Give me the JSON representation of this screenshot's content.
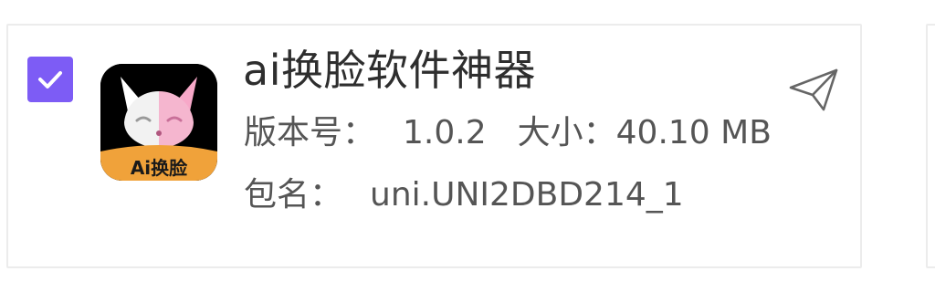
{
  "app": {
    "name": "ai换脸软件神器",
    "icon_label": "Ai换脸",
    "selected": true,
    "version_label": "版本号：",
    "version": "1.0.2",
    "size_label": "大小：",
    "size": "40.10 MB",
    "package_label": "包名：",
    "package": "uni.UNI2DBD214_1"
  },
  "icons": {
    "checkbox": "checkmark-icon",
    "share": "paper-plane-icon"
  },
  "colors": {
    "accent": "#7d5cf5",
    "icon_bg": "#000000",
    "icon_banner": "#f0a23a"
  }
}
